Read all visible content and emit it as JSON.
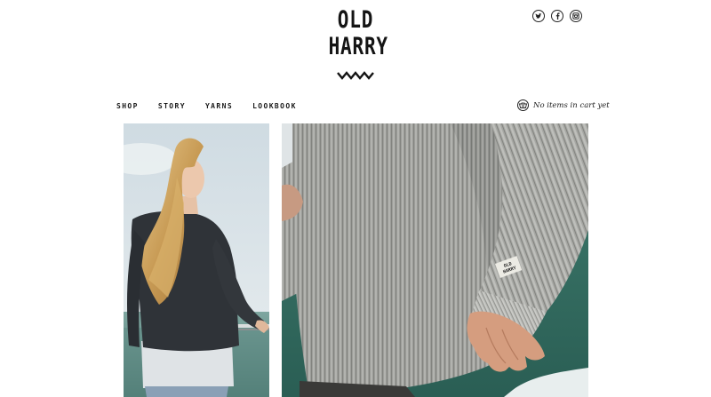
{
  "brand": {
    "line1": "OLD",
    "line2": "HARRY"
  },
  "social": [
    {
      "name": "twitter",
      "glyph": "t"
    },
    {
      "name": "facebook",
      "glyph": "f"
    },
    {
      "name": "instagram",
      "glyph": "◘"
    }
  ],
  "nav": {
    "items": [
      "SHOP",
      "STORY",
      "YARNS",
      "LOOKBOOK"
    ]
  },
  "cart": {
    "text": "No items in cart yet",
    "icon": "basket-icon"
  },
  "photos": {
    "left_icon": "woman-in-sweater-photo",
    "right_icon": "grey-knit-sweater-closeup-photo",
    "tag_text": "OLD HARRY"
  },
  "colors": {
    "text": "#1a1a1a",
    "sky": "#dfe6ea",
    "sea": "#4f7d75",
    "sweater_dark": "#2f3338",
    "knit_grey": "#9a9b97"
  }
}
